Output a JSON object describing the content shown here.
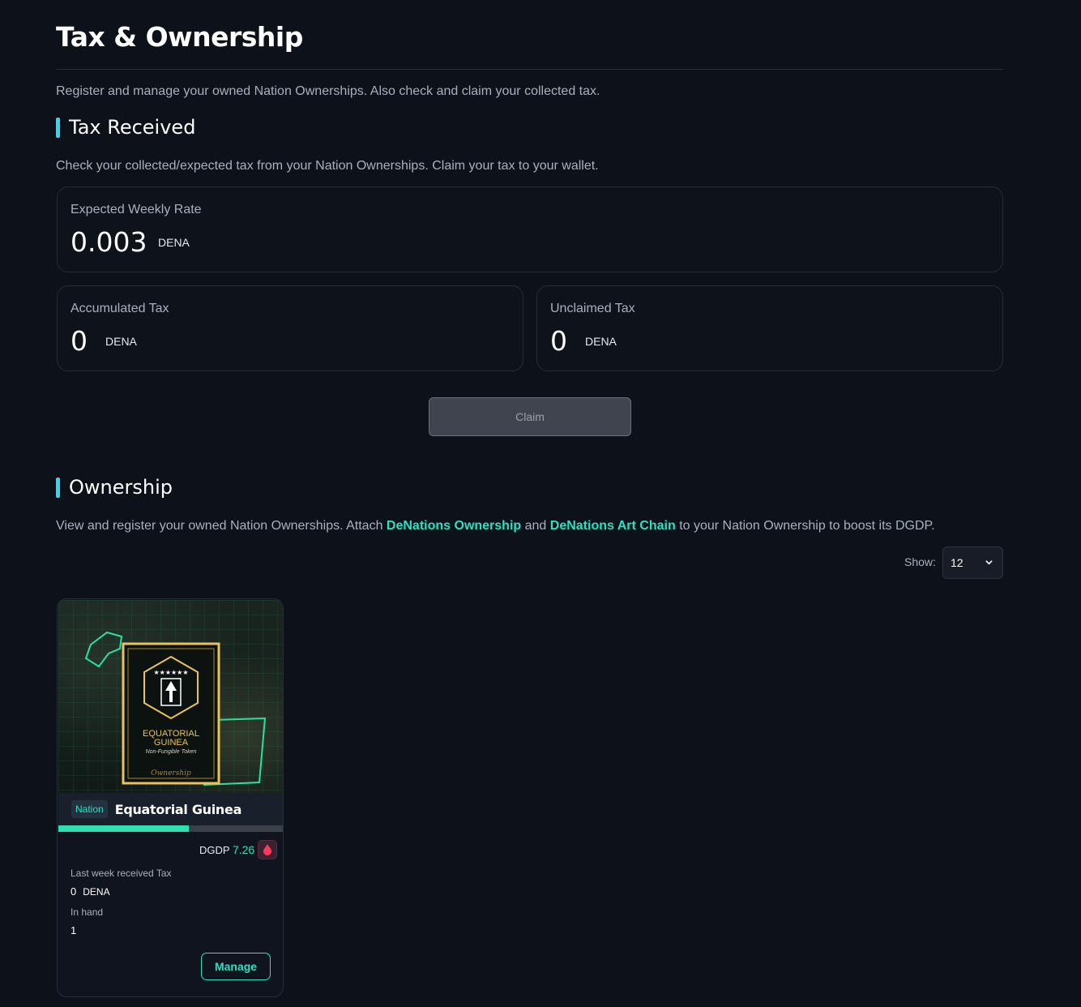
{
  "page": {
    "title": "Tax & Ownership",
    "description": "Register and manage your owned Nation Ownerships. Also check and claim your collected tax."
  },
  "tax_received": {
    "title": "Tax Received",
    "description": "Check your collected/expected tax from your Nation Ownerships. Claim your tax to your wallet.",
    "expected_weekly": {
      "label": "Expected Weekly Rate",
      "value": "0.003",
      "unit": "DENA"
    },
    "accumulated": {
      "label": "Accumulated Tax",
      "value": "0",
      "unit": "DENA"
    },
    "unclaimed": {
      "label": "Unclaimed Tax",
      "value": "0",
      "unit": "DENA"
    },
    "claim_label": "Claim"
  },
  "ownership": {
    "title": "Ownership",
    "desc_part1": "View and register your owned Nation Ownerships. Attach ",
    "link1": "DeNations Ownership",
    "desc_part2": " and ",
    "link2": "DeNations Art Chain",
    "desc_part3": " to your Nation Ownership to boost its DGDP.",
    "show_label": "Show:",
    "show_value": "12"
  },
  "cards": [
    {
      "art_title_line1": "EQUATORIAL",
      "art_title_line2": "GUINEA",
      "art_subtitle": "Non-Fungible Token",
      "art_script": "Ownership",
      "badge": "Nation",
      "name": "Equatorial Guinea",
      "progress": 0.58,
      "dgdp_label": "DGDP",
      "dgdp_value": "7.26",
      "last_week_label": "Last week received Tax",
      "last_week_value": "0",
      "last_week_unit": "DENA",
      "in_hand_label": "In hand",
      "in_hand_value": "1",
      "manage_label": "Manage"
    }
  ],
  "colors": {
    "background": "#0d111a",
    "accent_cyan": "#2ed8f0",
    "accent_green": "#2ee0c0",
    "gold": "#e8c25a"
  }
}
